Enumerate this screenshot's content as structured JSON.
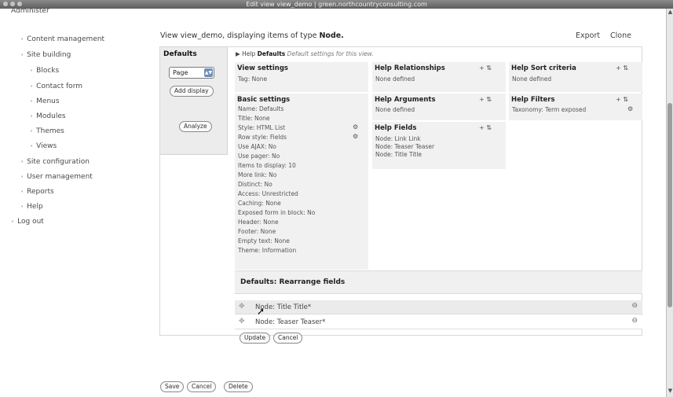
{
  "window": {
    "title": "Edit view view_demo | green.northcountryconsulting.com"
  },
  "sidebar": {
    "items": [
      {
        "label": "Administer"
      },
      {
        "label": "Content management"
      },
      {
        "label": "Site building"
      },
      {
        "label": "Blocks"
      },
      {
        "label": "Contact form"
      },
      {
        "label": "Menus"
      },
      {
        "label": "Modules"
      },
      {
        "label": "Themes"
      },
      {
        "label": "Views"
      },
      {
        "label": "Site configuration"
      },
      {
        "label": "User management"
      },
      {
        "label": "Reports"
      },
      {
        "label": "Help"
      },
      {
        "label": "Log out"
      }
    ]
  },
  "header": {
    "view_prefix": "View view_demo, displaying items of type",
    "view_type": "Node.",
    "export": "Export",
    "clone": "Clone"
  },
  "tabs": {
    "active": "Defaults",
    "select_value": "Page",
    "add_display": "Add display",
    "analyze": "Analyze"
  },
  "path": {
    "arrow": "▶",
    "help": "Help",
    "name": "Defaults",
    "desc": "Default settings for this view."
  },
  "sections": {
    "view_settings": {
      "title": "View settings",
      "tag": "Tag: None"
    },
    "basic_settings": {
      "title": "Basic settings",
      "lines": [
        "Name: Defaults",
        "Title: None",
        "Style: HTML List",
        "Row style: Fields",
        "Use AJAX: No",
        "Use pager: No",
        "Items to display: 10",
        "More link: No",
        "Distinct: No",
        "Access: Unrestricted",
        "Caching: None",
        "Exposed form in block: No",
        "Header: None",
        "Footer: None",
        "Empty text: None",
        "Theme: Information"
      ]
    },
    "relationships": {
      "title": "Help Relationships",
      "body": "None defined",
      "ctrl": "+ ⇅"
    },
    "arguments": {
      "title": "Help Arguments",
      "body": "None defined",
      "ctrl": "+ ⇅"
    },
    "fields": {
      "title": "Help Fields",
      "ctrl": "+ ⇅",
      "lines": [
        "Node: Link Link",
        "Node: Teaser Teaser",
        "Node: Title Title"
      ]
    },
    "sort": {
      "title": "Help Sort criteria",
      "body": "None defined",
      "ctrl": "+ ⇅"
    },
    "filters": {
      "title": "Help Filters",
      "body": "Taxonomy: Term exposed",
      "ctrl": "+ ⇅"
    }
  },
  "rearrange": {
    "title": "Defaults: Rearrange fields",
    "rows": [
      {
        "label": "Node: Title Title*"
      },
      {
        "label": "Node: Teaser Teaser*"
      }
    ],
    "update": "Update",
    "cancel": "Cancel"
  },
  "footer": {
    "save": "Save",
    "cancel": "Cancel",
    "delete": "Delete"
  },
  "colors": {
    "sidebar_bg": "#ffffff",
    "section_bg": "#f1f1f1",
    "select_caret": "#6f8fb5"
  }
}
